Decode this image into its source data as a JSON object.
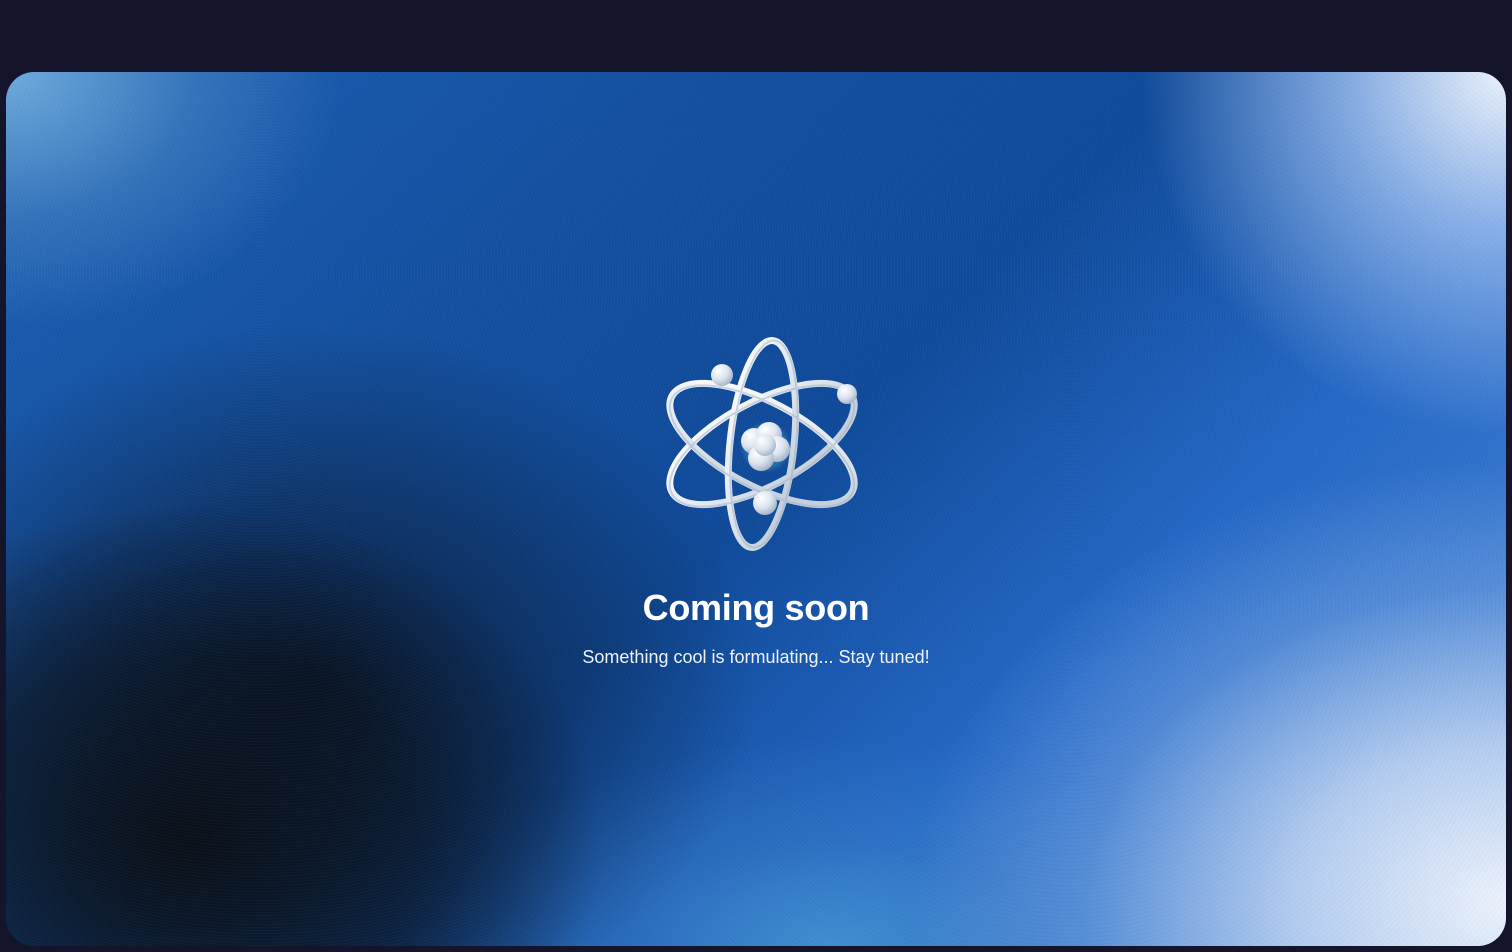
{
  "hero": {
    "icon": "atom-icon",
    "title": "Coming soon",
    "subtitle": "Something cool is formulating... Stay tuned!"
  },
  "colors": {
    "page_background": "#14142b",
    "panel_blue": "#0f4a9a",
    "panel_light": "#ecf2fc",
    "panel_dark": "#0a0e14",
    "text": "#ffffff"
  }
}
